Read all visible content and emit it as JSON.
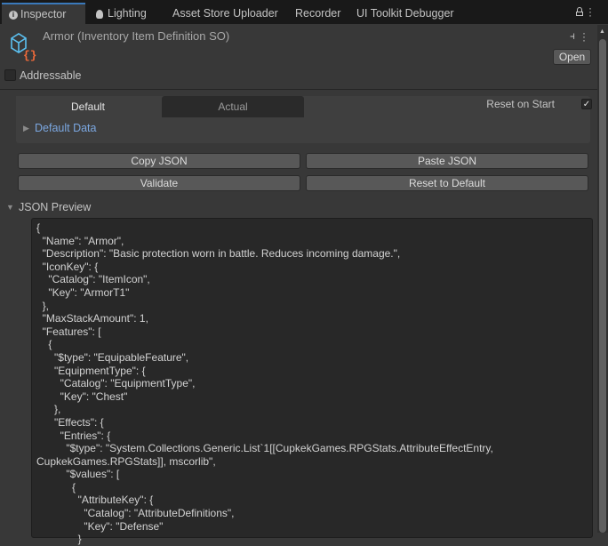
{
  "tabs": [
    {
      "label": "Inspector",
      "icon": "info-icon"
    },
    {
      "label": "Lighting",
      "icon": "lightbulb-icon"
    },
    {
      "label": "Asset Store Uploader"
    },
    {
      "label": "Recorder"
    },
    {
      "label": "UI Toolkit Debugger"
    }
  ],
  "header": {
    "title": "Armor (Inventory Item Definition SO)",
    "open_label": "Open",
    "addressable_label": "Addressable",
    "addressable_checked": false
  },
  "panel": {
    "tabs": [
      "Default",
      "Actual"
    ],
    "active_tab": "Default",
    "reset_on_start_label": "Reset on Start",
    "reset_on_start_checked": true,
    "foldout_label": "Default Data"
  },
  "buttons": {
    "copy": "Copy JSON",
    "paste": "Paste JSON",
    "validate": "Validate",
    "reset": "Reset to Default"
  },
  "preview": {
    "label": "JSON Preview",
    "lines": [
      "{",
      "  \"Name\": \"Armor\",",
      "  \"Description\": \"Basic protection worn in battle. Reduces incoming damage.\",",
      "  \"IconKey\": {",
      "    \"Catalog\": \"ItemIcon\",",
      "    \"Key\": \"ArmorT1\"",
      "  },",
      "  \"MaxStackAmount\": 1,",
      "  \"Features\": [",
      "    {",
      "      \"$type\": \"EquipableFeature\",",
      "      \"EquipmentType\": {",
      "        \"Catalog\": \"EquipmentType\",",
      "        \"Key\": \"Chest\"",
      "      },",
      "      \"Effects\": {",
      "        \"Entries\": {",
      "          \"$type\": \"System.Collections.Generic.List`1[[CupkekGames.RPGStats.AttributeEffectEntry,",
      "CupkekGames.RPGStats]], mscorlib\",",
      "          \"$values\": [",
      "            {",
      "              \"AttributeKey\": {",
      "                \"Catalog\": \"AttributeDefinitions\",",
      "                \"Key\": \"Defense\"",
      "              }"
    ]
  },
  "colors": {
    "accent": "#3a79bb",
    "link": "#7ba7e0",
    "background": "#383838"
  }
}
